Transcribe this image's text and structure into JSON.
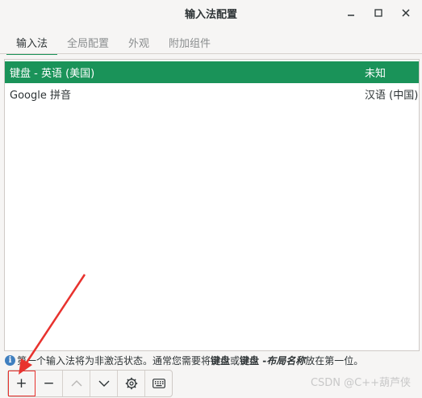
{
  "window": {
    "title": "输入法配置"
  },
  "tabs": [
    {
      "label": "输入法",
      "active": true
    },
    {
      "label": "全局配置",
      "active": false
    },
    {
      "label": "外观",
      "active": false
    },
    {
      "label": "附加组件",
      "active": false
    }
  ],
  "input_methods": [
    {
      "name": "键盘 - 英语 (美国)",
      "language": "未知",
      "selected": true
    },
    {
      "name": "Google 拼音",
      "language": "汉语 (中国)",
      "selected": false
    }
  ],
  "hint": {
    "part1": "第一个输入法将为非激活状态。通常您需要将",
    "bold1": "键盘",
    "part2": "或",
    "bold2": "键盘 - ",
    "italic": "布局名称",
    "part3": "放在第一位。"
  },
  "toolbar": {
    "add": "+",
    "remove": "−"
  },
  "watermark": "CSDN @C++葫芦侠",
  "colors": {
    "accent": "#1a9359",
    "annotation": "#e8322e"
  }
}
